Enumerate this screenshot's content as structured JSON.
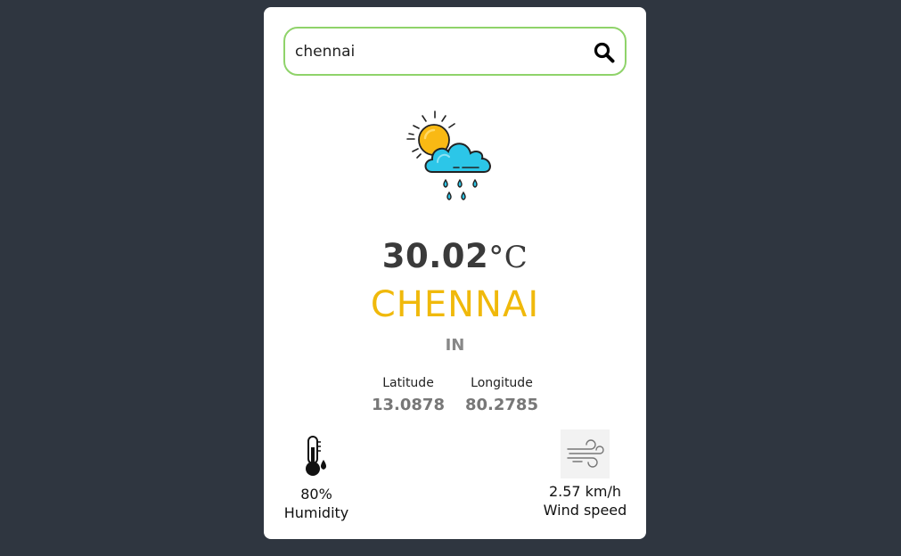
{
  "search": {
    "value": "chennai",
    "placeholder": ""
  },
  "weather": {
    "icon": "sun-cloud-rain-icon",
    "temperature": "30.02",
    "temperature_unit": "°C",
    "city": "CHENNAI",
    "country": "IN"
  },
  "coords": {
    "latitude_label": "Latitude",
    "latitude_value": "13.0878",
    "longitude_label": "Longitude",
    "longitude_value": "80.2785"
  },
  "stats": {
    "humidity_value": "80%",
    "humidity_label": "Humidity",
    "wind_value": "2.57 km/h",
    "wind_label": "Wind speed"
  },
  "colors": {
    "background": "#2f3640",
    "card": "#ffffff",
    "search_border": "#8fd36a",
    "city": "#f0b90b"
  }
}
